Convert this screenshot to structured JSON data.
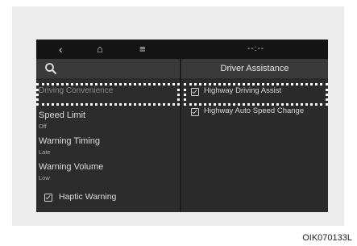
{
  "topbar": {
    "back_icon": "‹",
    "home_icon": "⌂",
    "menu_icon": "≡",
    "time_text": "--:--"
  },
  "left_panel": {
    "selected_item": "Driving Convenience",
    "items": [
      {
        "label": "Speed Limit",
        "value": "Off"
      },
      {
        "label": "Warning Timing",
        "value": "Late"
      },
      {
        "label": "Warning Volume",
        "value": "Low"
      }
    ],
    "haptic_label": "Haptic Warning"
  },
  "right_panel": {
    "title": "Driver Assistance",
    "options": [
      {
        "label": "Highway Driving Assist",
        "checked": true
      },
      {
        "label": "Highway Auto Speed Change",
        "checked": true
      }
    ]
  },
  "figure_code": "OIK070133L"
}
